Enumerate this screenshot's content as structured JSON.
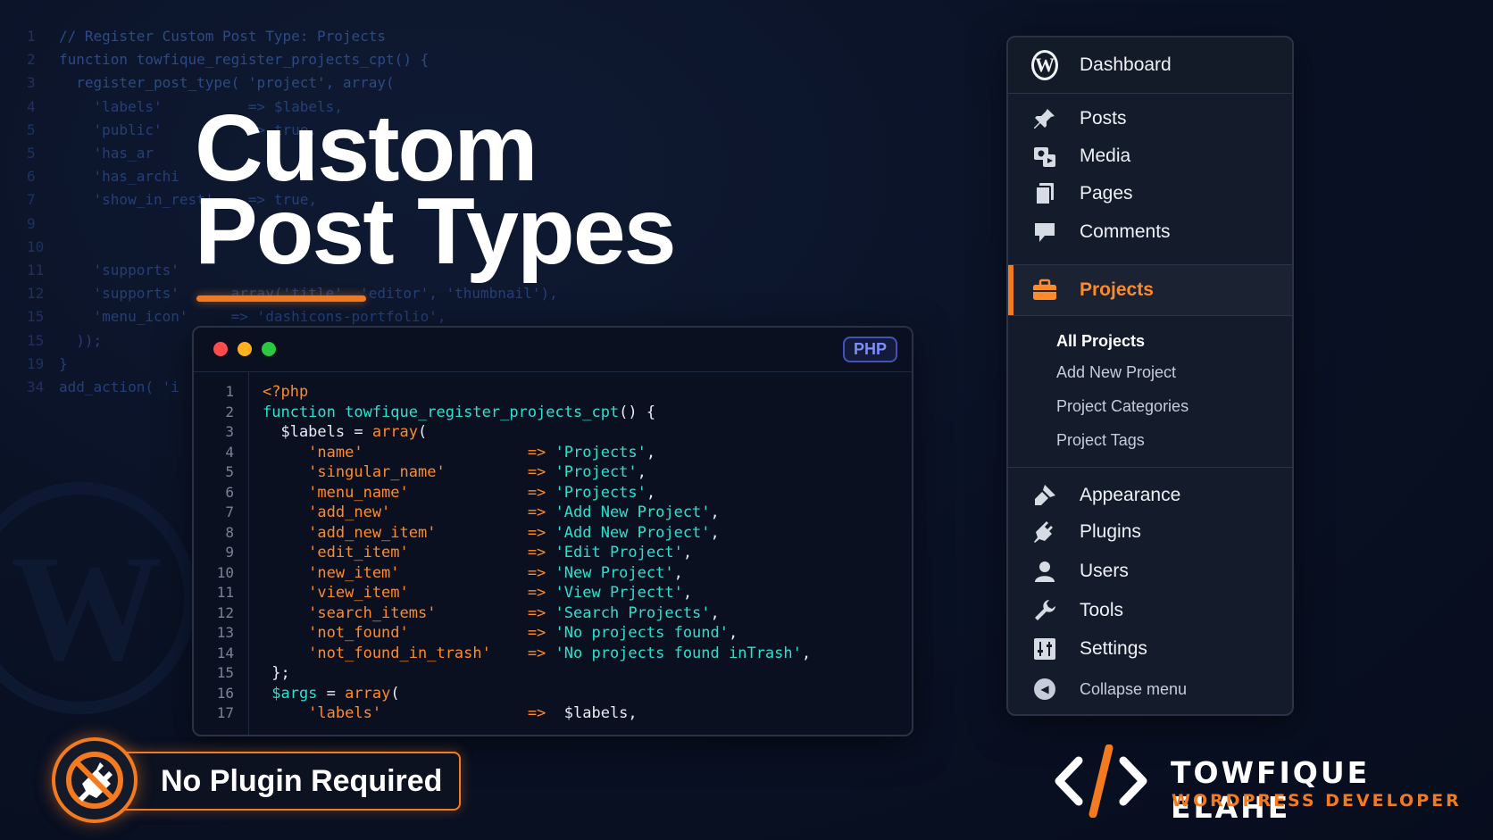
{
  "background_code": [
    {
      "n": "1",
      "t": "// Register Custom Post Type: Projects"
    },
    {
      "n": "2",
      "t": "function towfique_register_projects_cpt() {"
    },
    {
      "n": "3",
      "t": "  register_post_type( 'project', array("
    },
    {
      "n": "4",
      "t": "    'labels'          => $labels,"
    },
    {
      "n": "5",
      "t": "    'public'          => true,"
    },
    {
      "n": "5",
      "t": "    'has_ar"
    },
    {
      "n": "6",
      "t": "    'has_archi"
    },
    {
      "n": "7",
      "t": "    'show_in_rest'    => true,"
    },
    {
      "n": "9",
      "t": ""
    },
    {
      "n": "10",
      "t": ""
    },
    {
      "n": "11",
      "t": "    'supports'"
    },
    {
      "n": "12",
      "t": "    'supports'      array('title', 'editor', 'thumbnail'),"
    },
    {
      "n": "15",
      "t": "    'menu_icon'     => 'dashicons-portfolio',"
    },
    {
      "n": "15",
      "t": "  ));"
    },
    {
      "n": "19",
      "t": "}"
    },
    {
      "n": "34",
      "t": "add_action( 'i"
    }
  ],
  "headline": {
    "line1": "Custom",
    "line2": "Post Types"
  },
  "code_window": {
    "language_badge": "PHP",
    "window_dots": [
      "close",
      "minimize",
      "maximize"
    ],
    "line_numbers": [
      "1",
      "2",
      "3",
      "4",
      "5",
      "6",
      "7",
      "8",
      "9",
      "10",
      "11",
      "12",
      "13",
      "14",
      "15",
      "16",
      "17"
    ],
    "lines": [
      {
        "key": "<?php"
      },
      {
        "kw": "function ",
        "fn": "towfique_register_projects_cpt",
        "rest": "() {"
      },
      {
        "var": "  $labels = ",
        "fn2": "array",
        "rest": "("
      },
      {
        "key": "'name'",
        "val": "'Projects'"
      },
      {
        "key": "'singular_name'",
        "val": "'Project'"
      },
      {
        "key": "'menu_name'",
        "val": "'Projects'"
      },
      {
        "key": "'add_new'",
        "val": "'Add New Project'"
      },
      {
        "key": "'add_new_item'",
        "val": "'Add New Project'"
      },
      {
        "key": "'edit_item'",
        "val": "'Edit Project'"
      },
      {
        "key": "'new_item'",
        "val": "'New Project'"
      },
      {
        "key": "'view_item'",
        "val": "'View Prjectt'"
      },
      {
        "key": "'search_items'",
        "val": "'Search Projects'"
      },
      {
        "key": "'not_found'",
        "val": "'No projects found'"
      },
      {
        "key": "'not_found_in_trash'",
        "val": "'No projects found inTrash'"
      },
      {
        "plain": "  };"
      },
      {
        "argsvar": "  $args",
        "argsrest": " = ",
        "fn2": "array",
        "rest": "("
      },
      {
        "key": "'labels'",
        "valw": "$labels"
      }
    ],
    "arrow": "=>"
  },
  "admin_menu": {
    "dashboard": "Dashboard",
    "items_top": [
      {
        "label": "Posts",
        "icon": "pushpin-icon"
      },
      {
        "label": "Media",
        "icon": "media-icon"
      },
      {
        "label": "Pages",
        "icon": "pages-icon"
      },
      {
        "label": "Comments",
        "icon": "comment-icon"
      }
    ],
    "active": {
      "label": "Projects",
      "icon": "briefcase-icon",
      "color": "#f47a1f"
    },
    "submenu": [
      "All Projects",
      "Add New Project",
      "Project Categories",
      "Project Tags"
    ],
    "items_bottom": [
      {
        "label": "Appearance",
        "icon": "brush-icon"
      },
      {
        "label": "Plugins",
        "icon": "plug-icon"
      },
      {
        "label": "Users",
        "icon": "user-icon"
      },
      {
        "label": "Tools",
        "icon": "wrench-icon"
      },
      {
        "label": "Settings",
        "icon": "sliders-icon"
      }
    ],
    "collapse": "Collapse menu"
  },
  "badge": {
    "text": "No Plugin Required",
    "icon": "no-plug-icon"
  },
  "brand": {
    "name": "TOWFIQUE ELAHE",
    "role": "WORDPRESS DEVELOPER",
    "accent": "#f47a1f"
  }
}
